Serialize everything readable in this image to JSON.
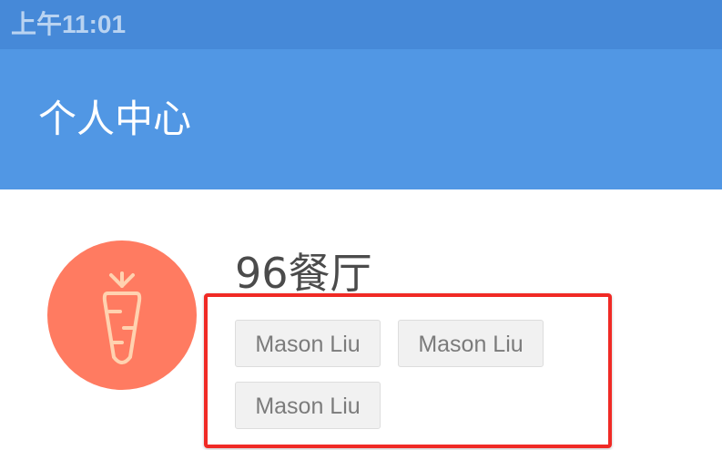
{
  "status_bar": {
    "time": "上午11:01"
  },
  "header": {
    "title": "个人中心"
  },
  "profile": {
    "avatar_icon": "carrot-icon",
    "name": "96餐厅",
    "tags": [
      "Mason Liu",
      "Mason Liu",
      "Mason Liu"
    ]
  },
  "colors": {
    "status_bar": "#4689d8",
    "app_bar": "#5197e4",
    "avatar_bg": "#ff7b61",
    "highlight": "#f02a25"
  }
}
